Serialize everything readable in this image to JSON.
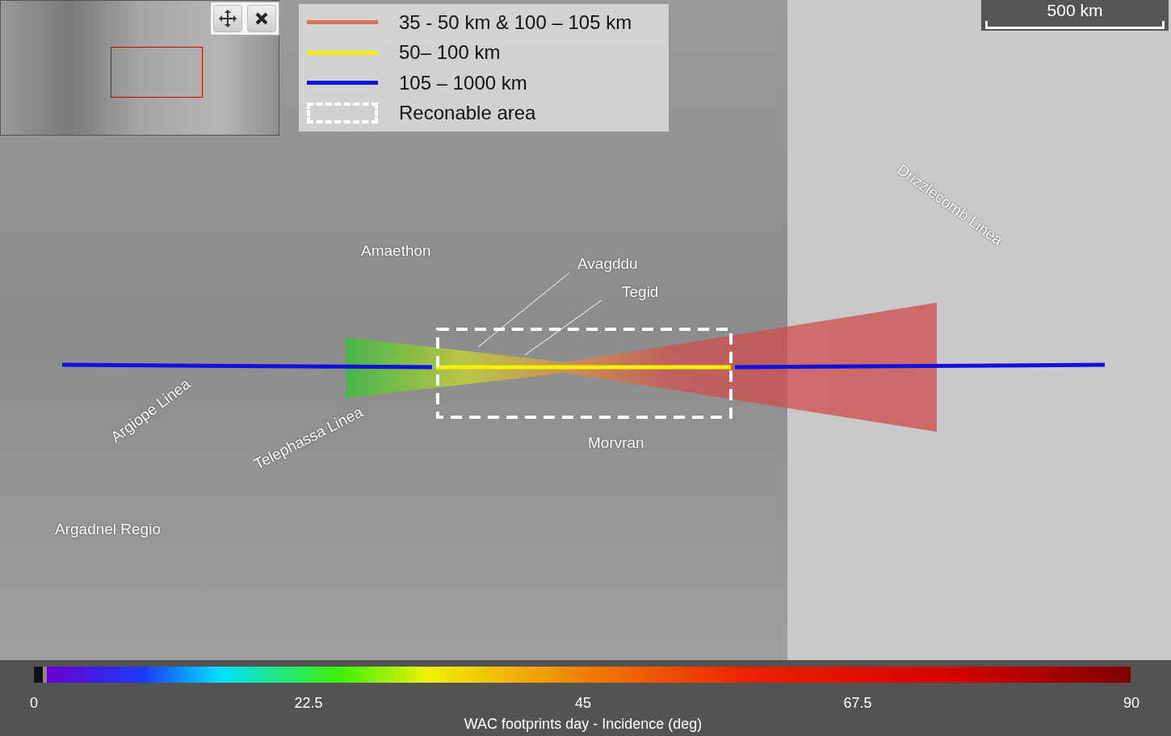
{
  "legend": [
    {
      "kind": "line",
      "color": "#e0705a",
      "label": "35 - 50 km & 100 – 105 km"
    },
    {
      "kind": "line",
      "color": "#f5f000",
      "label": "50– 100 km"
    },
    {
      "kind": "line",
      "color": "#1010e0",
      "label": "105 – 1000 km"
    },
    {
      "kind": "dashed",
      "color": "#ffffff",
      "label": "Reconable area"
    }
  ],
  "scale_bar": {
    "label": "500 km"
  },
  "place_labels": [
    "Amaethon",
    "Avagddu",
    "Tegid",
    "Morvran",
    "Argadnel Regio",
    "Argiope Linea",
    "Telephassa Linea",
    "Drizzlecomb Linea"
  ],
  "colorbar": {
    "ticks": [
      "0",
      "22.5",
      "45",
      "67.5",
      "90"
    ],
    "title": "WAC footprints day - Incidence (deg)"
  }
}
